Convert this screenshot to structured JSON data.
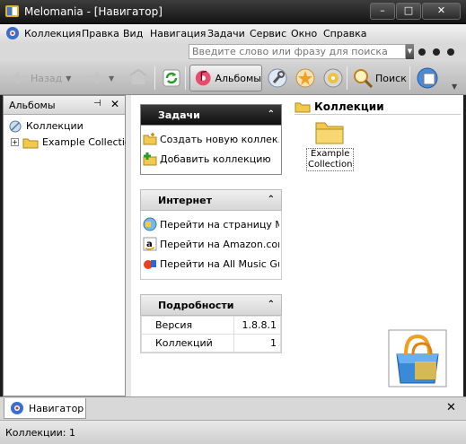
{
  "window": {
    "title": "Melomania - [Навигатор]",
    "minimize_glyph": "–",
    "maximize_glyph": "□",
    "close_glyph": "✕"
  },
  "menu": {
    "items": [
      "Коллекция",
      "Правка",
      "Вид",
      "Навигация",
      "Задачи",
      "Сервис",
      "Окно",
      "Справка"
    ]
  },
  "search": {
    "placeholder": "Введите слово или фразу для поиска",
    "value": ""
  },
  "toolbar": {
    "back_label": "Назад",
    "albums_label": "Альбомы",
    "search_label": "Поиск",
    "refresh_icon": "refresh-icon",
    "settings_icon": "wrench-icon"
  },
  "left_panel": {
    "title": "Альбомы",
    "pin_glyph": "⊣",
    "close_glyph": "✕",
    "tree": {
      "root": "Коллекции",
      "children": [
        "Example Collection"
      ],
      "expander_glyph": "+"
    }
  },
  "tasks": {
    "title": "Задачи",
    "collapse_glyph": "⌃",
    "links": [
      "Создать новую коллек...",
      "Добавить коллекцию"
    ]
  },
  "internet": {
    "title": "Интернет",
    "collapse_glyph": "⌃",
    "links": [
      "Перейти на страницу М...",
      "Перейти на Amazon.com",
      "Перейти на All Music Guide"
    ]
  },
  "details": {
    "title": "Подробности",
    "collapse_glyph": "⌃",
    "rows": [
      {
        "label": "Версия",
        "value": "1.8.8.1"
      },
      {
        "label": "Коллекций",
        "value": "1"
      }
    ]
  },
  "collections": {
    "header": "Коллекции",
    "items": [
      {
        "label_line1": "Example",
        "label_line2": "Collection"
      }
    ]
  },
  "bottom_tab": {
    "label": "Навигатор",
    "close_glyph": "✕"
  },
  "status": {
    "text": "Коллекции: 1"
  },
  "colors": {
    "title_bar": "#1e1e1e",
    "panel_header_dark": "#1a1a1a",
    "folder_yellow": "#f2c94c"
  }
}
